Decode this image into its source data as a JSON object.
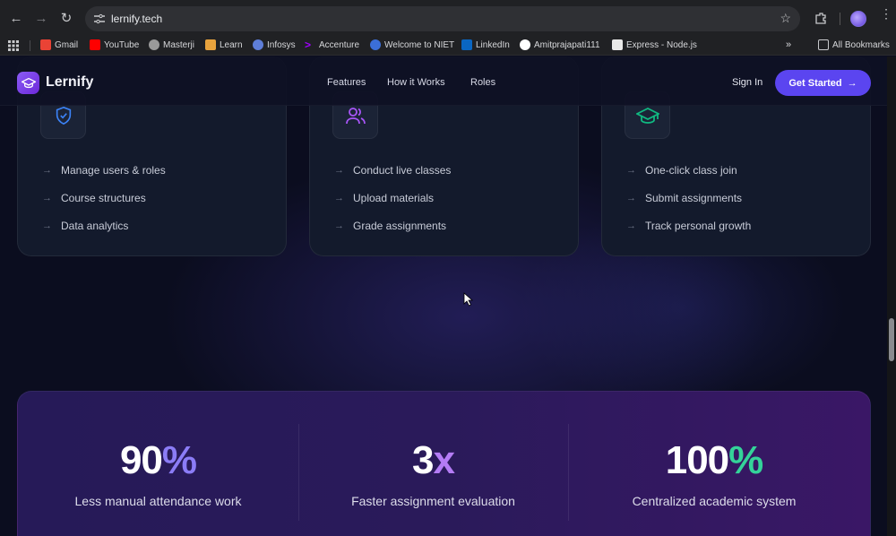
{
  "browser": {
    "url": "lernify.tech",
    "bookmarks": [
      {
        "label": "Gmail",
        "icon": "gmail-icon",
        "color": "#ea4335"
      },
      {
        "label": "YouTube",
        "icon": "youtube-icon",
        "color": "#ff0000"
      },
      {
        "label": "Masterji",
        "icon": "masterji-icon",
        "color": "#cfcfcf"
      },
      {
        "label": "Learn",
        "icon": "learn-icon",
        "color": "#e8a33d"
      },
      {
        "label": "Infosys",
        "icon": "infosys-icon",
        "color": "#5e7ed8"
      },
      {
        "label": "Accenture",
        "icon": "accenture-icon",
        "color": "#a100ff"
      },
      {
        "label": "Welcome to NIET",
        "icon": "niet-icon",
        "color": "#3b6fd8"
      },
      {
        "label": "LinkedIn",
        "icon": "linkedin-icon",
        "color": "#0a66c2"
      },
      {
        "label": "Amitprajapati111",
        "icon": "github-icon",
        "color": "#ffffff"
      },
      {
        "label": "Express - Node.js",
        "icon": "express-icon",
        "color": "#ffffff"
      }
    ],
    "all_bookmarks": "All Bookmarks"
  },
  "site": {
    "brand": "Lernify",
    "nav": [
      "Features",
      "How it Works",
      "Roles"
    ],
    "sign_in": "Sign In",
    "cta": "Get Started"
  },
  "roles": [
    {
      "icon": "shield-check-icon",
      "color": "#3b82f6",
      "features": [
        "Manage users & roles",
        "Course structures",
        "Data analytics"
      ]
    },
    {
      "icon": "users-icon",
      "color": "#a855f7",
      "features": [
        "Conduct live classes",
        "Upload materials",
        "Grade assignments"
      ]
    },
    {
      "icon": "graduation-cap-icon",
      "color": "#10b981",
      "features": [
        "One-click class join",
        "Submit assignments",
        "Track personal growth"
      ]
    }
  ],
  "stats": [
    {
      "num": "90",
      "suffix": "%",
      "suffix_color": "#8b7cf6",
      "label": "Less manual attendance work"
    },
    {
      "num": "3",
      "suffix": "x",
      "suffix_color": "#b47cf5",
      "label": "Faster assignment evaluation"
    },
    {
      "num": "100",
      "suffix": "%",
      "suffix_color": "#34d399",
      "label": "Centralized academic system"
    }
  ]
}
